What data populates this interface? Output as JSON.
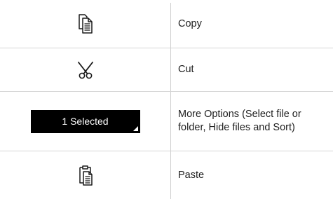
{
  "rows": [
    {
      "icon": "copy-icon",
      "label": "Copy"
    },
    {
      "icon": "cut-icon",
      "label": "Cut"
    },
    {
      "icon": "selection-chip",
      "chip_text": "1 Selected",
      "label": "More Options (Select file or folder, Hide files and Sort)"
    },
    {
      "icon": "paste-icon",
      "label": "Paste"
    }
  ],
  "colors": {
    "chip_background": "#000000",
    "chip_text": "#ffffff",
    "divider": "#d4d4d4"
  }
}
